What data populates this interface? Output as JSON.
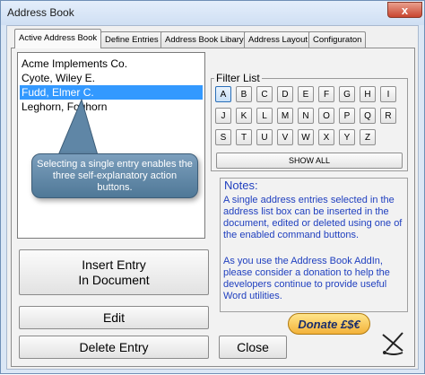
{
  "window": {
    "title": "Address Book",
    "close_glyph": "x"
  },
  "tabs": [
    {
      "label": "Active Address Book",
      "active": true
    },
    {
      "label": "Define Entries",
      "active": false
    },
    {
      "label": "Address Book Libary",
      "active": false
    },
    {
      "label": "Address Layout",
      "active": false
    },
    {
      "label": "Configuraton",
      "active": false
    }
  ],
  "address_list": {
    "items": [
      "Acme Implements Co.",
      "Cyote, Wiley E.",
      "Fudd, Elmer C.",
      "Leghorn, Foghorn"
    ],
    "selected_index": 2
  },
  "callout": {
    "text": "Selecting a single entry enables the three self-explanatory action buttons."
  },
  "buttons": {
    "insert_entry_line1": "Insert Entry",
    "insert_entry_line2": "In Document",
    "edit": "Edit",
    "delete_entry": "Delete Entry",
    "close": "Close",
    "donate": "Donate £$€"
  },
  "filter": {
    "label": "Filter List",
    "selected": "A",
    "keys": [
      "A",
      "B",
      "C",
      "D",
      "E",
      "F",
      "G",
      "H",
      "I",
      "J",
      "K",
      "L",
      "M",
      "N",
      "O",
      "P",
      "Q",
      "R",
      "S",
      "T",
      "U",
      "V",
      "W",
      "X",
      "Y",
      "Z"
    ],
    "show_all": "SHOW ALL"
  },
  "notes": {
    "title": "Notes:",
    "paragraph1": "A single address entries selected in the address list box can be inserted in the document, edited or deleted using one of the enabled command buttons.",
    "paragraph2": "As you use the Address Book AddIn, please consider a donation to help the developers continue to provide useful Word utilities."
  },
  "colors": {
    "selection": "#3399ff",
    "notes_text": "#1f3fbf",
    "callout": "#5f86a6"
  },
  "icons": {
    "close": "close-icon",
    "tools": "anchor-tool-icon"
  }
}
